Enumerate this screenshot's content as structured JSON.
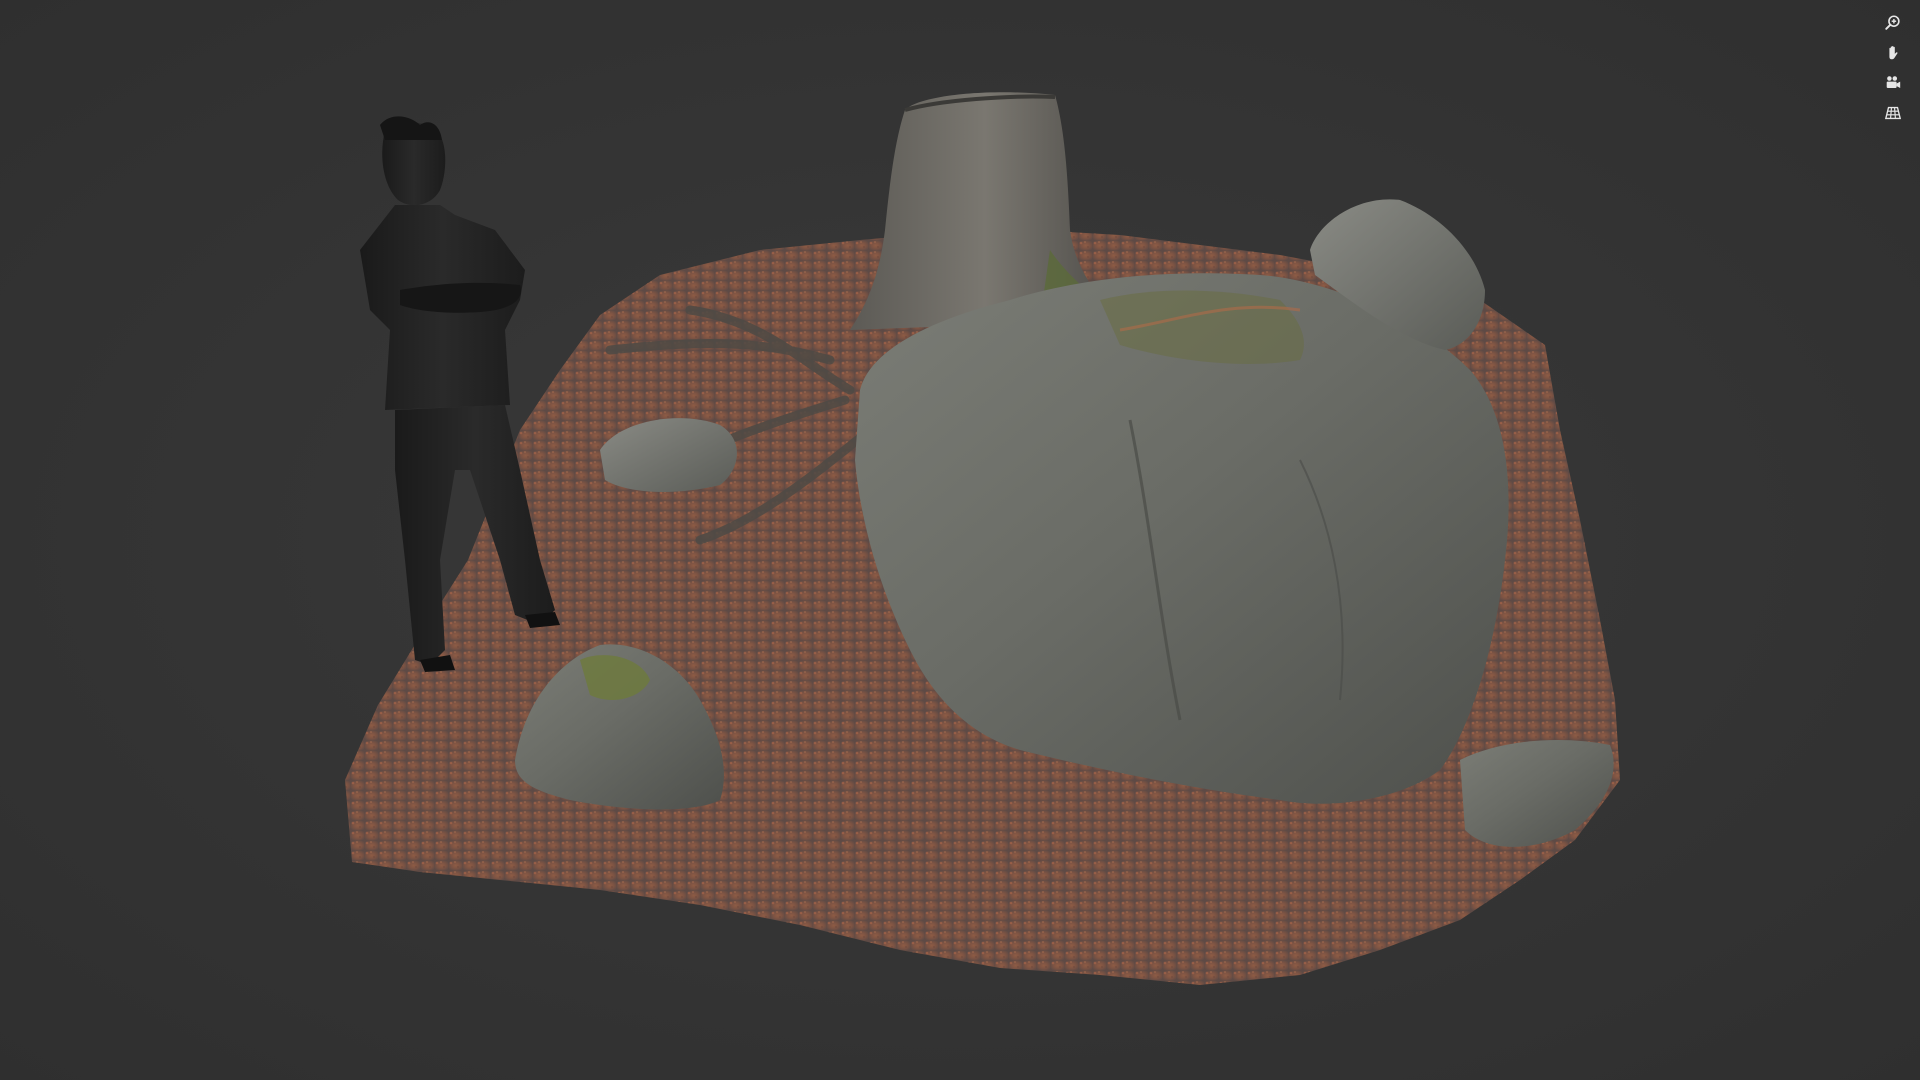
{
  "viewer": {
    "background": "#333333",
    "scene": {
      "model": "rock-and-tree-stump-scan",
      "reference": "human-scale-figure"
    }
  },
  "toolbar": {
    "buttons": [
      {
        "name": "zoom-icon",
        "icon": "zoom-in"
      },
      {
        "name": "pan-hand-icon",
        "icon": "hand"
      },
      {
        "name": "camera-icon",
        "icon": "video-camera"
      },
      {
        "name": "grid-icon",
        "icon": "grid-floor"
      }
    ],
    "icon_color": "#e6e6e6"
  },
  "colors": {
    "ground_leaves": "#8a5a44",
    "rock": "#6b6c66",
    "moss": "#5f6a3a",
    "figure": "#1f1f1f"
  }
}
